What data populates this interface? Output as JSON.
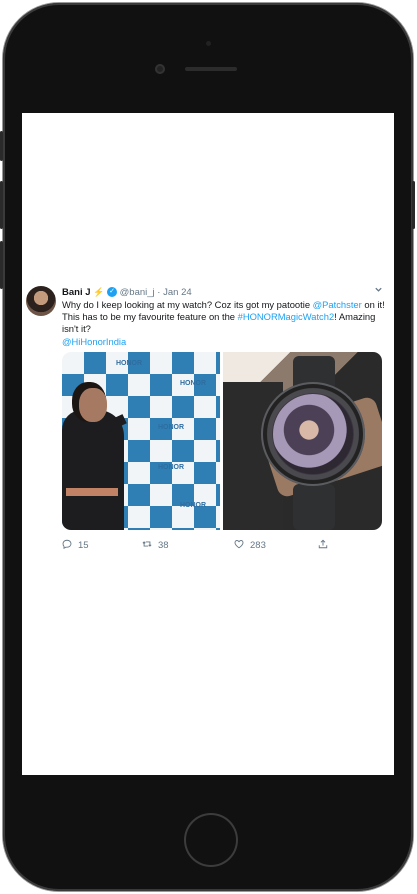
{
  "tweet": {
    "author_name": "Bani J",
    "author_emoji": "⚡",
    "handle": "@bani_j",
    "separator": "·",
    "date": "Jan 24",
    "text_part1": "Why do I keep looking at my watch? Coz its got my patootie ",
    "mention_patchster": "@Patchster",
    "text_part2": " on it! This has to be my favourite feature on the ",
    "hashtag": "#HONORMagicWatch2",
    "text_part3": "! Amazing isn't it?",
    "mention_hihonor": "@HiHonorIndia",
    "backdrop_brand": "HONOR",
    "counts": {
      "replies": "15",
      "retweets": "38",
      "likes": "283"
    }
  },
  "colors": {
    "link": "#1da1f2",
    "text": "#14171a",
    "muted": "#657786",
    "verified": "#1da1f2"
  },
  "icons": {
    "reply": "reply-icon",
    "retweet": "retweet-icon",
    "like": "heart-icon",
    "share": "share-icon",
    "more": "chevron-down-icon",
    "verified": "verified-badge-icon"
  }
}
